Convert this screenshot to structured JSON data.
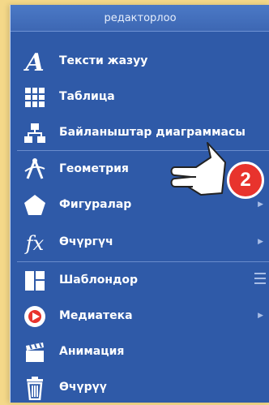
{
  "header": {
    "title": "редакторлоо"
  },
  "items": [
    {
      "label": "Тексти жазуу",
      "icon": "text-a-icon"
    },
    {
      "label": "Таблица",
      "icon": "table-grid-icon"
    },
    {
      "label": "Байланыштар диаграммасы",
      "icon": "org-chart-icon"
    },
    {
      "label": "Геометрия",
      "icon": "geometry-compass-icon"
    },
    {
      "label": "Фигуралар",
      "icon": "pentagon-icon",
      "submenu": true
    },
    {
      "label": "Өчүргүч",
      "icon": "function-fx-icon",
      "submenu": true
    },
    {
      "label": "Шаблондор",
      "icon": "layout-template-icon",
      "menu": true
    },
    {
      "label": "Медиатека",
      "icon": "media-play-icon",
      "submenu": true
    },
    {
      "label": "Анимация",
      "icon": "clapperboard-icon"
    },
    {
      "label": "Өчүрүү",
      "icon": "trash-icon"
    }
  ],
  "callout": {
    "number": "2",
    "color": "#e8332d",
    "icon": "pointing-hand-icon"
  },
  "colors": {
    "panel": "#2f5aa8",
    "background": "#f4d889"
  }
}
